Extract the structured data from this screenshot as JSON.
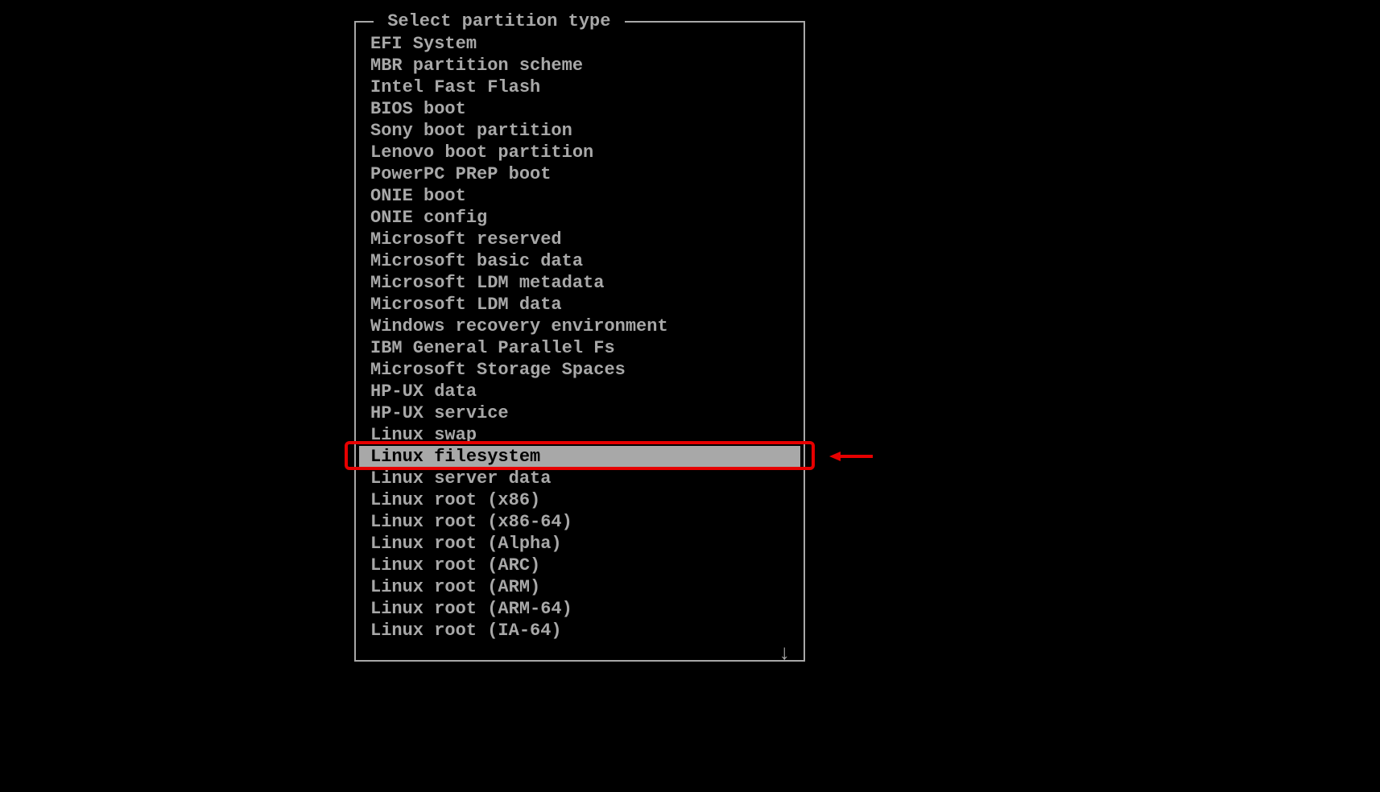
{
  "dialog": {
    "title": " Select partition type ",
    "items": [
      "EFI System",
      "MBR partition scheme",
      "Intel Fast Flash",
      "BIOS boot",
      "Sony boot partition",
      "Lenovo boot partition",
      "PowerPC PReP boot",
      "ONIE boot",
      "ONIE config",
      "Microsoft reserved",
      "Microsoft basic data",
      "Microsoft LDM metadata",
      "Microsoft LDM data",
      "Windows recovery environment",
      "IBM General Parallel Fs",
      "Microsoft Storage Spaces",
      "HP-UX data",
      "HP-UX service",
      "Linux swap",
      "Linux filesystem",
      "Linux server data",
      "Linux root (x86)",
      "Linux root (x86-64)",
      "Linux root (Alpha)",
      "Linux root (ARC)",
      "Linux root (ARM)",
      "Linux root (ARM-64)",
      "Linux root (IA-64)"
    ],
    "selected_index": 19,
    "scroll_indicator": "↓"
  }
}
